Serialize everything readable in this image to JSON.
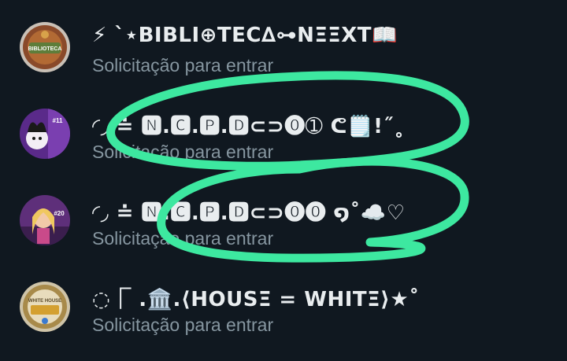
{
  "requests": [
    {
      "name": "⚡ ˋ⋆BIBLI⊕TEC∆⊶NΞΞXT📖",
      "subtitle": "Solicitação para entrar",
      "avatar_label": "BIBLIOTECA"
    },
    {
      "name": "◜◞ ≐ 🅽.🅲.🅿.🅳⊂⊃⓿➀ ᕦ🗒️!˝˳",
      "subtitle": "Solicitação para entrar",
      "avatar_label": "#11"
    },
    {
      "name": "◜◞ ≐ 🅽.🅲.🅿.🅳⊂⊃⓿⓿ ໑˚☁️♡",
      "subtitle": "Solicitação para entrar",
      "avatar_label": "#20"
    },
    {
      "name": "◌⎾ .🏛️.⟨HOUSΞ = WHITΞ⟩★˚",
      "subtitle": "Solicitação para entrar",
      "avatar_label": "WHITE HOUSE"
    }
  ],
  "colors": {
    "background": "#101820",
    "name_text": "#e9edef",
    "subtitle_text": "#8696a0",
    "annotation_stroke": "#3de8a0"
  }
}
